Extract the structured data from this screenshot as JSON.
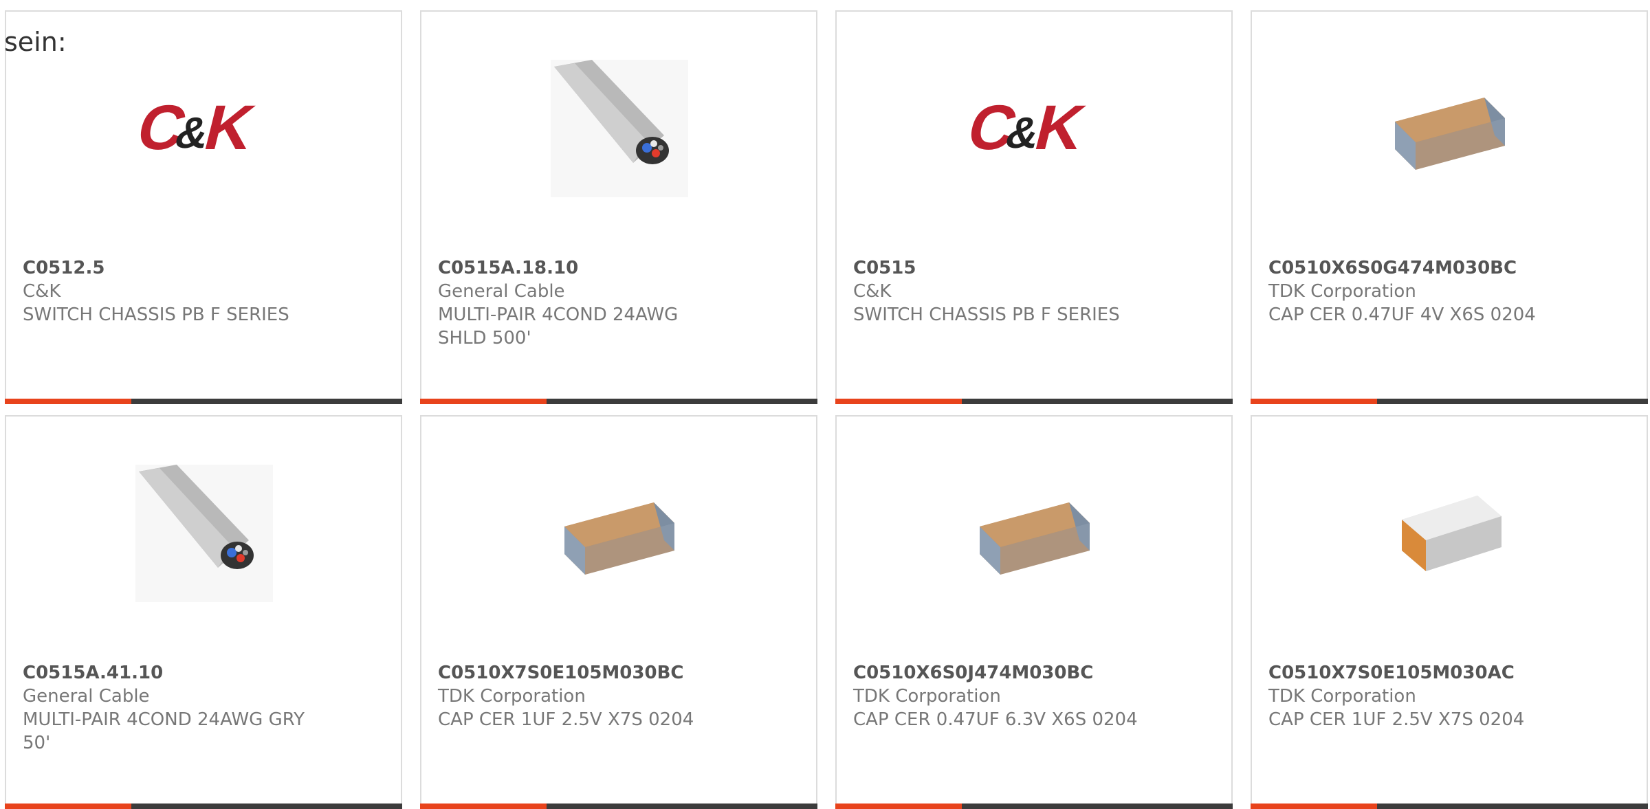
{
  "page": {
    "label": "sein:"
  },
  "colors": {
    "card_border": "#dcdcdc",
    "bar_dark": "#3c3c3c",
    "bar_accent": "#e8431c",
    "ck_red": "#c0202e",
    "text_primary": "#555555",
    "text_secondary": "#777777"
  },
  "products": [
    {
      "part_number": "C0512.5",
      "manufacturer": "C&K",
      "description": "SWITCH CHASSIS PB F SERIES",
      "image": "ck-logo"
    },
    {
      "part_number": "C0515A.18.10",
      "manufacturer": "General Cable",
      "description": "MULTI-PAIR 4COND 24AWG SHLD 500'",
      "image": "cable"
    },
    {
      "part_number": "C0515",
      "manufacturer": "C&K",
      "description": "SWITCH CHASSIS PB F SERIES",
      "image": "ck-logo"
    },
    {
      "part_number": "C0510X6S0G474M030BC",
      "manufacturer": "TDK Corporation",
      "description": "CAP CER 0.47UF 4V X6S 0204",
      "image": "capacitor"
    },
    {
      "part_number": "C0515A.41.10",
      "manufacturer": "General Cable",
      "description": "MULTI-PAIR 4COND 24AWG GRY 50'",
      "image": "cable"
    },
    {
      "part_number": "C0510X7S0E105M030BC",
      "manufacturer": "TDK Corporation",
      "description": "CAP CER 1UF 2.5V X7S 0204",
      "image": "capacitor"
    },
    {
      "part_number": "C0510X6S0J474M030BC",
      "manufacturer": "TDK Corporation",
      "description": "CAP CER 0.47UF 6.3V X6S 0204",
      "image": "capacitor"
    },
    {
      "part_number": "C0510X7S0E105M030AC",
      "manufacturer": "TDK Corporation",
      "description": "CAP CER 1UF 2.5V X7S 0204",
      "image": "capacitor-white"
    }
  ]
}
